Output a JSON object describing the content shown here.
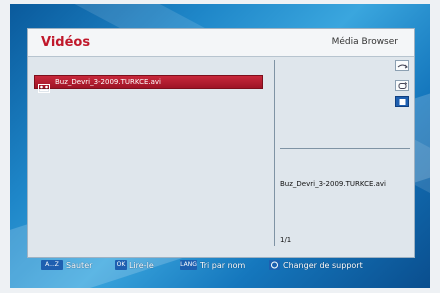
{
  "header": {
    "title": "Vidéos",
    "app_name": "Média Browser"
  },
  "files": [
    {
      "name": "Buz_Devri_3-2009.TURKCE.avi",
      "icon": "video-file-icon",
      "selected": true
    }
  ],
  "side_icons": [
    "repeat-icon",
    "shuffle-icon",
    "stop-icon"
  ],
  "preview": {
    "filename": "Buz_Devri_3-2009.TURKCE.avi",
    "page": "1/1"
  },
  "footer": {
    "hints": [
      {
        "key": "A...Z",
        "label": "Sauter"
      },
      {
        "key": "OK",
        "label": "Lire-le"
      },
      {
        "key": "LANG",
        "label": "Tri par nom"
      },
      {
        "key": "",
        "label": "Changer de support",
        "icon": "circle-key-icon"
      }
    ]
  },
  "colors": {
    "accent_red": "#c0182b",
    "key_blue": "#1e5fb0",
    "background_blue": "#1e86c8"
  }
}
